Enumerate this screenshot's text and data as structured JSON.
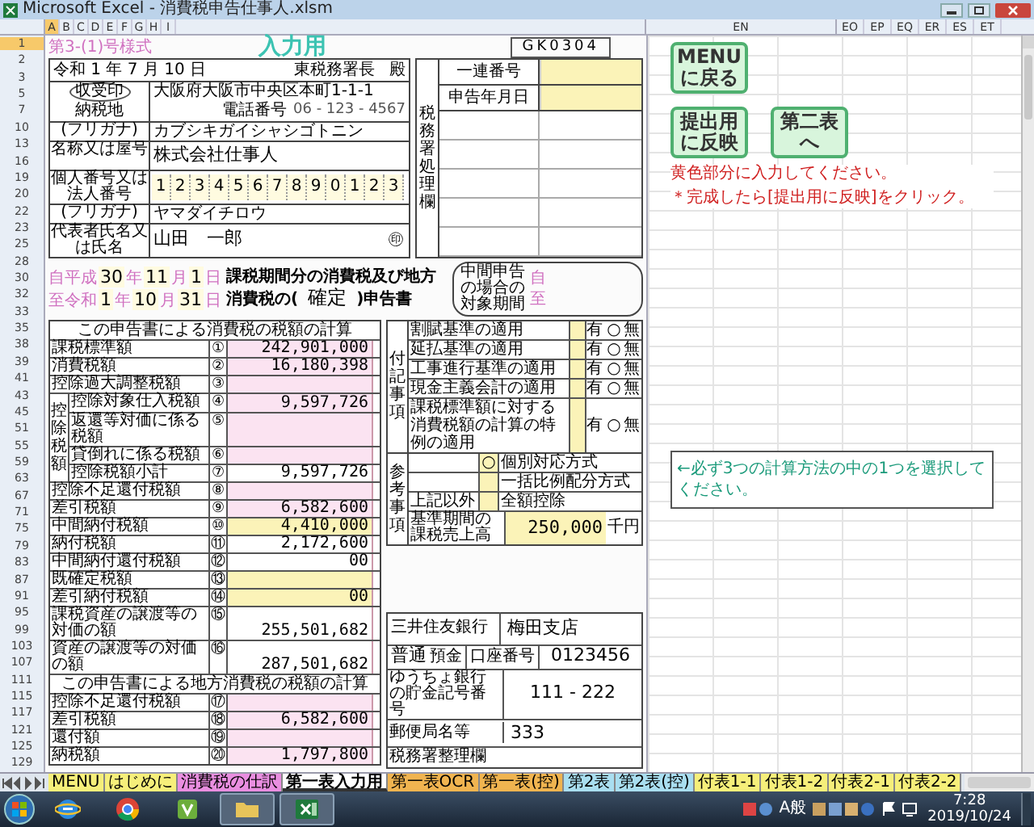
{
  "window": {
    "title": "Microsoft Excel - 消費税申告仕事人.xlsm"
  },
  "column_headers": {
    "left": [
      {
        "label": "A",
        "selected": true
      },
      {
        "label": "B",
        "selected": false
      },
      {
        "label": "C",
        "selected": false
      },
      {
        "label": "D",
        "selected": false
      },
      {
        "label": "E",
        "selected": false
      },
      {
        "label": "F",
        "selected": false
      },
      {
        "label": "G",
        "selected": false
      },
      {
        "label": "H",
        "selected": false
      },
      {
        "label": "I",
        "selected": false
      }
    ],
    "middle": "EN",
    "right": [
      "EO",
      "EP",
      "EQ",
      "ER",
      "ES",
      "ET"
    ]
  },
  "row_numbers": [
    {
      "label": "1",
      "selected": true
    },
    {
      "label": "2",
      "selected": false
    },
    {
      "label": "3",
      "selected": false
    },
    {
      "label": "5",
      "selected": false
    },
    {
      "label": "7",
      "selected": false
    },
    {
      "label": "10",
      "selected": false
    },
    {
      "label": "13",
      "selected": false
    },
    {
      "label": "16",
      "selected": false
    },
    {
      "label": "19",
      "selected": false
    },
    {
      "label": "20",
      "selected": false
    },
    {
      "label": "22",
      "selected": false
    },
    {
      "label": "23",
      "selected": false
    },
    {
      "label": "25",
      "selected": false
    },
    {
      "label": "28",
      "selected": false
    },
    {
      "label": "30",
      "selected": false
    },
    {
      "label": "32",
      "selected": false
    },
    {
      "label": "33",
      "selected": false
    },
    {
      "label": "35",
      "selected": false
    },
    {
      "label": "38",
      "selected": false
    },
    {
      "label": "39",
      "selected": false
    },
    {
      "label": "41",
      "selected": false
    },
    {
      "label": "43",
      "selected": false
    },
    {
      "label": "45",
      "selected": false
    },
    {
      "label": "51",
      "selected": false
    },
    {
      "label": "55",
      "selected": false
    },
    {
      "label": "59",
      "selected": false
    },
    {
      "label": "63",
      "selected": false
    },
    {
      "label": "67",
      "selected": false
    },
    {
      "label": "71",
      "selected": false
    },
    {
      "label": "75",
      "selected": false
    },
    {
      "label": "79",
      "selected": false
    },
    {
      "label": "83",
      "selected": false
    },
    {
      "label": "87",
      "selected": false
    },
    {
      "label": "91",
      "selected": false
    },
    {
      "label": "95",
      "selected": false
    },
    {
      "label": "99",
      "selected": false
    },
    {
      "label": "103",
      "selected": false
    },
    {
      "label": "107",
      "selected": false
    },
    {
      "label": "111",
      "selected": false
    },
    {
      "label": "115",
      "selected": false
    },
    {
      "label": "117",
      "selected": false
    },
    {
      "label": "121",
      "selected": false
    },
    {
      "label": "125",
      "selected": false
    },
    {
      "label": "129",
      "selected": false
    }
  ],
  "form": {
    "form_code": "第3-(1)号様式",
    "heading": "入力用",
    "doc_id": "GK0304",
    "date": "令和 1 年 7 月 10 日",
    "office": "東税務署長",
    "honorific": "殿",
    "stamp": "収受印",
    "address": {
      "label": "納税地",
      "value": "大阪府大阪市中央区本町1-1-1",
      "phone_label": "電話番号",
      "phone": "06 - 123 - 4567"
    },
    "name_kana": {
      "label": "(フリガナ)",
      "value": "カブシキガイシャシゴトニン"
    },
    "name": {
      "label": "名称又は屋号",
      "value": "株式会社仕事人"
    },
    "number": {
      "label": "個人番号又は法人番号",
      "digits": [
        "1",
        "2",
        "3",
        "4",
        "5",
        "6",
        "7",
        "8",
        "9",
        "0",
        "1",
        "2",
        "3"
      ]
    },
    "rep_kana": {
      "label": "(フリガナ)",
      "value": "ヤマダイチロウ"
    },
    "rep": {
      "label": "代表者氏名又は氏名",
      "value": "山田　一郎",
      "seal": "㊞"
    },
    "office_use": {
      "title": "税務署処理欄",
      "rows": [
        "一連番号",
        "申告年月日"
      ]
    },
    "period": [
      {
        "label": "自平成",
        "parts": [
          "30",
          "年",
          "11",
          "月",
          "1",
          "日"
        ]
      },
      {
        "label": "至令和",
        "parts": [
          "1",
          "年",
          "10",
          "月",
          "31",
          "日"
        ]
      }
    ],
    "return_title": {
      "line1": "課税期間分の消費税及び地方",
      "prefix": "消費税の(",
      "value": "確定",
      "suffix": ")申告書"
    },
    "interim": {
      "label": "中間申告の場合の対象期間",
      "from": "自",
      "to": "至"
    }
  },
  "tax_table": {
    "title": "この申告書による消費税の税額の計算",
    "rows": [
      {
        "kind": "row",
        "label": "課税標準額",
        "no": "①",
        "amount": "242,901,000",
        "color": "#fbe3f1"
      },
      {
        "kind": "row",
        "label": "消費税額",
        "no": "②",
        "amount": "16,180,398",
        "color": "#fbe3f1"
      },
      {
        "kind": "row",
        "label": "控除過大調整税額",
        "no": "③",
        "color": "#fbe3f1"
      },
      {
        "kind": "group",
        "label": "控除税額",
        "rows": [
          {
            "label": "控除対象仕入税額",
            "no": "④",
            "amount": "9,597,726",
            "color": "#fbe3f1"
          },
          {
            "label": "返還等対価に係る税額",
            "no": "⑤",
            "color": "#fbe3f1"
          },
          {
            "label": "貸倒れに係る税額",
            "no": "⑥",
            "color": "#fbe3f1"
          },
          {
            "label": "控除税額小計",
            "no": "⑦",
            "amount": "9,597,726",
            "color": "#ffffff"
          }
        ]
      },
      {
        "kind": "row",
        "label": "控除不足還付税額",
        "no": "⑧",
        "color": "#fbe3f1"
      },
      {
        "kind": "row",
        "label": "差引税額",
        "no": "⑨",
        "amount": "6,582,600",
        "color": "#fbe3f1"
      },
      {
        "kind": "row",
        "label": "中間納付税額",
        "no": "⑩",
        "amount": "4,410,000",
        "color": "#fbf3b8"
      },
      {
        "kind": "row",
        "label": "納付税額",
        "no": "⑪",
        "amount": "2,172,600",
        "color": "#ffffff"
      },
      {
        "kind": "row",
        "label": "中間納付還付税額",
        "no": "⑫",
        "amount": "00",
        "color": "#ffffff"
      },
      {
        "kind": "row",
        "label": "既確定税額",
        "no": "⑬",
        "color": "#fbf3b8"
      },
      {
        "kind": "row",
        "label": "差引納付税額",
        "no": "⑭",
        "amount": "00",
        "color": "#fbf3b8"
      },
      {
        "kind": "row",
        "label": "課税資産の譲渡等の対価の額",
        "no": "⑮",
        "amount": "255,501,682",
        "color": "#ffffff"
      },
      {
        "kind": "row",
        "label": "資産の譲渡等の対価の額",
        "no": "⑯",
        "amount": "287,501,682",
        "color": "#ffffff"
      }
    ]
  },
  "local_table": {
    "title": "この申告書による地方消費税の税額の計算",
    "rows": [
      {
        "label": "控除不足還付税額",
        "no": "⑰",
        "color": "#fbe3f1"
      },
      {
        "label": "差引税額",
        "no": "⑱",
        "amount": "6,582,600",
        "color": "#fbe3f1"
      },
      {
        "label": "還付額",
        "no": "⑲",
        "color": "#fbe3f1"
      },
      {
        "label": "納税額",
        "no": "⑳",
        "amount": "1,797,800",
        "color": "#fbe3f1"
      }
    ]
  },
  "notes_table": {
    "title": "付記事項",
    "rows": [
      {
        "label": "割賦基準の適用",
        "yes": "有",
        "mark": "○",
        "no": "無"
      },
      {
        "label": "延払基準の適用",
        "yes": "有",
        "mark": "○",
        "no": "無"
      },
      {
        "label": "工事進行基準の適用",
        "yes": "有",
        "mark": "○",
        "no": "無"
      },
      {
        "label": "現金主義会計の適用",
        "yes": "有",
        "mark": "○",
        "no": "無"
      },
      {
        "label": "課税標準額に対する消費税額の計算の特例の適用",
        "yes": "有",
        "mark": "○",
        "no": "無"
      }
    ]
  },
  "reference": {
    "title": "参考事項",
    "rows": [
      {
        "mark": "○",
        "option": "個別対応方式"
      },
      {
        "option": "一括比例配分方式"
      },
      {
        "label": "上記以外",
        "option": "全額控除"
      }
    ],
    "base": {
      "label": "基準期間の課税売上高",
      "value": "250,000",
      "unit": "千円"
    }
  },
  "bank": {
    "bank": "三井住友銀行",
    "branch": "梅田支店",
    "account_type": "普通",
    "account_suffix": "預金",
    "account_label": "口座番号",
    "account": "0123456",
    "postal_label": "ゆうちょ銀行の貯金記号番号",
    "postal": "111 - 222",
    "post_office_label": "郵便局名等",
    "post_office": "333",
    "office_label": "税務署整理欄"
  },
  "buttons": [
    {
      "label": "MENUに戻る"
    },
    {
      "label": "提出用に反映"
    },
    {
      "label": "第二表へ"
    }
  ],
  "notes": [
    "黄色部分に入力してください。",
    "＊完成したら[提出用に反映]をクリック。"
  ],
  "hint": "←必ず3つの計算方法の中の1つを選択してください。",
  "sheet_tabs": [
    {
      "label": "MENU",
      "selected": false,
      "color": "#f6ef7a"
    },
    {
      "label": "はじめに",
      "selected": false,
      "color": "#f6ef7a"
    },
    {
      "label": "消費税の仕訳",
      "selected": false,
      "color": "#e98ee0"
    },
    {
      "label": "第一表入力用",
      "selected": true,
      "color": "#ffffff"
    },
    {
      "label": "第一表OCR",
      "selected": false,
      "color": "#f0b450"
    },
    {
      "label": "第一表(控)",
      "selected": false,
      "color": "#f0b450"
    },
    {
      "label": "第2表",
      "selected": false,
      "color": "#a9def0"
    },
    {
      "label": "第2表(控)",
      "selected": false,
      "color": "#a9def0"
    },
    {
      "label": "付表1-1",
      "selected": false,
      "color": "#f6ef7a"
    },
    {
      "label": "付表1-2",
      "selected": false,
      "color": "#f6ef7a"
    },
    {
      "label": "付表2-1",
      "selected": false,
      "color": "#f6ef7a"
    },
    {
      "label": "付表2-2",
      "selected": false,
      "color": "#f6ef7a"
    }
  ],
  "taskbar": {
    "apps": [
      {
        "kind": "browser",
        "active": false
      },
      {
        "kind": "chrome",
        "active": false
      },
      {
        "kind": "app",
        "active": false
      },
      {
        "kind": "folder",
        "active": true
      },
      {
        "kind": "excel",
        "active": true
      }
    ],
    "ime": "A般",
    "time": "7:28",
    "date": "2019/10/24"
  }
}
